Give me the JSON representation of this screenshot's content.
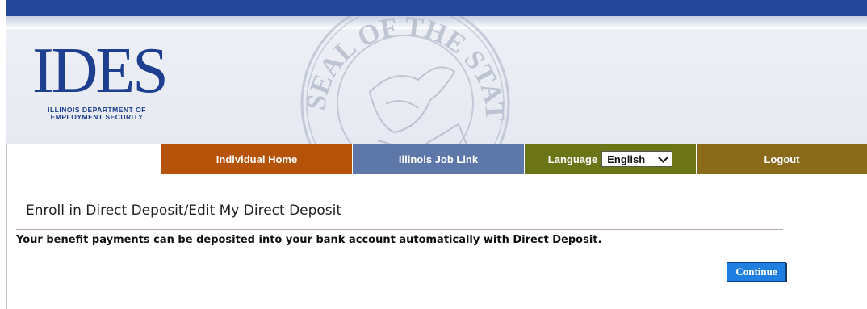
{
  "logo": {
    "letters": "IDES",
    "subtitle_line1": "ILLINOIS DEPARTMENT OF",
    "subtitle_line2": "EMPLOYMENT SECURITY"
  },
  "seal": {
    "text": "SEAL OF THE STATE OF ILLINOIS"
  },
  "nav": {
    "home_label": "Individual Home",
    "job_link_label": "Illinois Job Link",
    "language_label": "Language",
    "language_selected": "English",
    "logout_label": "Logout"
  },
  "main": {
    "heading": "Enroll in Direct Deposit/Edit My Direct Deposit",
    "description": "Your benefit payments can be deposited into your bank account automatically with Direct Deposit.",
    "continue_label": "Continue"
  },
  "colors": {
    "top_bar": "#25479a",
    "nav_home": "#b45309",
    "nav_job": "#5e77a9",
    "nav_language": "#6b7417",
    "nav_logout": "#8a6a1b",
    "continue_button": "#1e7fe0"
  }
}
